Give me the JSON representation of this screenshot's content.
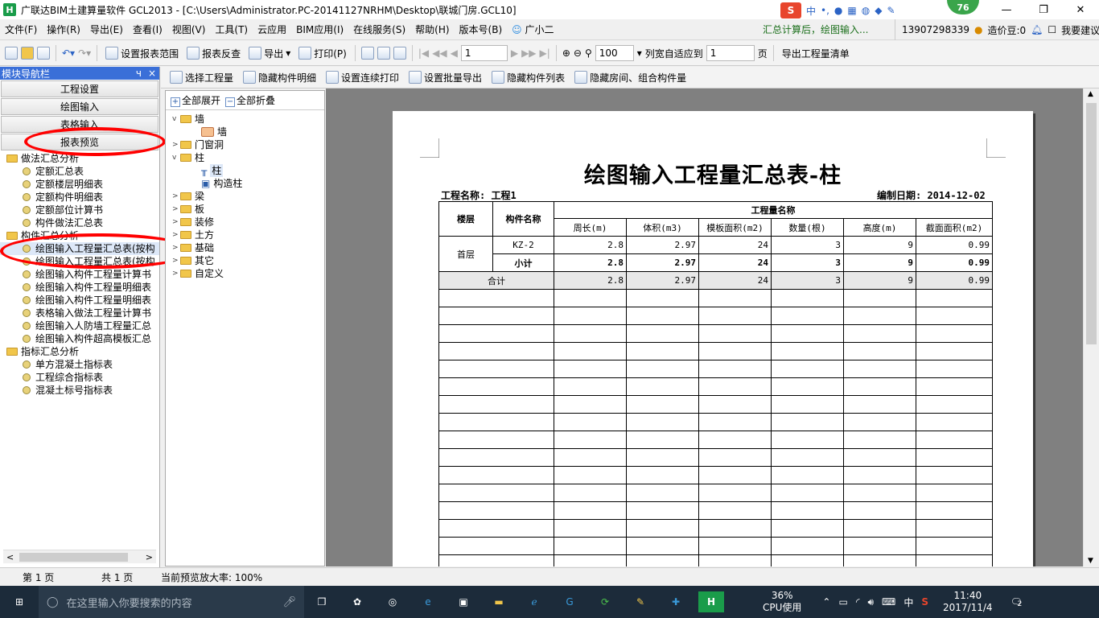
{
  "window": {
    "title": "广联达BIM土建算量软件 GCL2013 - [C:\\Users\\Administrator.PC-20141127NRHM\\Desktop\\联城门房.GCL10]",
    "logo_glyph": "H",
    "ime": {
      "lang": "中",
      "punct": "•,",
      "badge": "S"
    },
    "score": "76",
    "controls": {
      "minimize": "—",
      "restore": "❐",
      "close": "✕"
    }
  },
  "menubar": {
    "items": [
      "文件(F)",
      "操作(R)",
      "导出(E)",
      "查看(I)",
      "视图(V)",
      "工具(T)",
      "云应用",
      "BIM应用(I)",
      "在线服务(S)",
      "帮助(H)",
      "版本号(B)",
      "广小二"
    ],
    "notice": "汇总计算后，绘图输入...",
    "phone": "13907298339",
    "coins": "造价豆:0",
    "feedback": "我要建议"
  },
  "toolbar1": {
    "set_range": "设置报表范围",
    "check": "报表反查",
    "export": "导出",
    "print": "打印(P)",
    "page_input": "1",
    "zoom": "100",
    "fit_width": "列宽自适应到",
    "fit_value": "1",
    "page_unit": "页",
    "export_list": "导出工程量清单"
  },
  "subtoolbar": {
    "items": [
      "选择工程量",
      "隐藏构件明细",
      "设置连续打印",
      "设置批量导出",
      "隐藏构件列表",
      "隐藏房间、组合构件量"
    ]
  },
  "navpanel": {
    "title": "模块导航栏",
    "pin": "ч",
    "close": "×",
    "buttons": [
      "工程设置",
      "绘图输入",
      "表格输入",
      "报表预览"
    ],
    "groups": [
      {
        "label": "做法汇总分析",
        "items": [
          "定额汇总表",
          "定额楼层明细表",
          "定额构件明细表",
          "定额部位计算书",
          "构件做法汇总表"
        ]
      },
      {
        "label": "构件汇总分析",
        "items": [
          "绘图输入工程量汇总表(按构",
          "绘图输入工程量汇总表(按构",
          "绘图输入构件工程量计算书",
          "绘图输入构件工程量明细表",
          "绘图输入构件工程量明细表",
          "表格输入做法工程量计算书",
          "绘图输入人防墙工程量汇总",
          "绘图输入构件超高模板汇总"
        ]
      },
      {
        "label": "指标汇总分析",
        "items": [
          "单方混凝土指标表",
          "工程综合指标表",
          "混凝土标号指标表"
        ]
      }
    ],
    "scroll_left": "<",
    "scroll_right": ">"
  },
  "treepanel": {
    "expand_all": "全部展开",
    "collapse_all": "全部折叠",
    "nodes": [
      {
        "label": "墙",
        "children": [
          "墙"
        ]
      },
      {
        "label": "门窗洞",
        "children": []
      },
      {
        "label": "柱",
        "children": [
          "柱",
          "构造柱"
        ]
      },
      {
        "label": "梁",
        "children": []
      },
      {
        "label": "板",
        "children": []
      },
      {
        "label": "装修",
        "children": []
      },
      {
        "label": "土方",
        "children": []
      },
      {
        "label": "基础",
        "children": []
      },
      {
        "label": "其它",
        "children": []
      },
      {
        "label": "自定义",
        "children": []
      }
    ]
  },
  "report": {
    "title": "绘图输入工程量汇总表-柱",
    "project_label": "工程名称: 工程1",
    "date_label": "编制日期: 2014-12-02",
    "headers": {
      "floor": "楼层",
      "component": "构件名称",
      "group": "工程量名称",
      "cols": [
        "周长(m)",
        "体积(m3)",
        "模板面积(m2)",
        "数量(根)",
        "高度(m)",
        "截面面积(m2)"
      ]
    },
    "floor_name": "首层",
    "row": {
      "name": "KZ-2",
      "values": [
        "2.8",
        "2.97",
        "24",
        "3",
        "9",
        "0.99"
      ]
    },
    "subtotal": {
      "name": "小计",
      "values": [
        "2.8",
        "2.97",
        "24",
        "3",
        "9",
        "0.99"
      ]
    },
    "total": {
      "name": "合计",
      "values": [
        "2.8",
        "2.97",
        "24",
        "3",
        "9",
        "0.99"
      ]
    }
  },
  "statusbar": {
    "page": "第 1 页",
    "total": "共 1 页",
    "zoom": "当前预览放大率: 100%"
  },
  "taskbar": {
    "search_placeholder": "在这里输入你要搜索的内容",
    "cpu_value": "36%",
    "cpu_label": "CPU使用",
    "ime": "中",
    "time": "11:40",
    "date": "2017/11/4",
    "notify_count": "2"
  },
  "colors": {
    "nav_header": "#3a6fd8",
    "annotation": "#ff0000",
    "taskbar": "#1c2b3a",
    "preview_bg": "#808080"
  }
}
